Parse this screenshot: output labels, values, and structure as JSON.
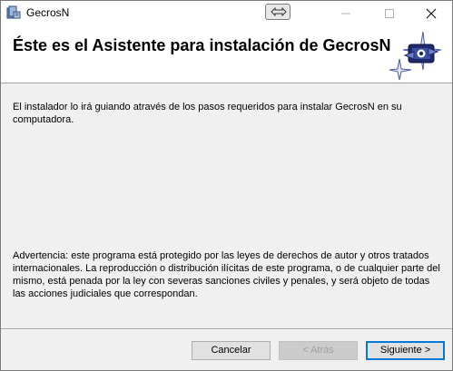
{
  "window": {
    "title": "GecrosN"
  },
  "banner": {
    "title": "Éste es el Asistente para instalación de GecrosN"
  },
  "body": {
    "intro": "El instalador lo irá guiando através de los pasos requeridos para instalar GecrosN  en su computadora.",
    "warning": "Advertencia: este programa está protegido por las leyes de derechos de autor y otros tratados internacionales. La reproducción o distribución ilícitas de este programa, o de cualquier parte del mismo, está penada por la ley con severas sanciones civiles y penales, y será objeto de todas las acciones judiciales que correspondan."
  },
  "buttons": {
    "cancel": "Cancelar",
    "back": "< Atrás",
    "next": "Siguiente >"
  },
  "icons": {
    "app": "installer-icon",
    "restore": "restore-arrows-icon",
    "minimize": "minimize-icon",
    "maximize": "maximize-icon",
    "close": "close-icon",
    "logo": "sparkle-computer-logo"
  }
}
